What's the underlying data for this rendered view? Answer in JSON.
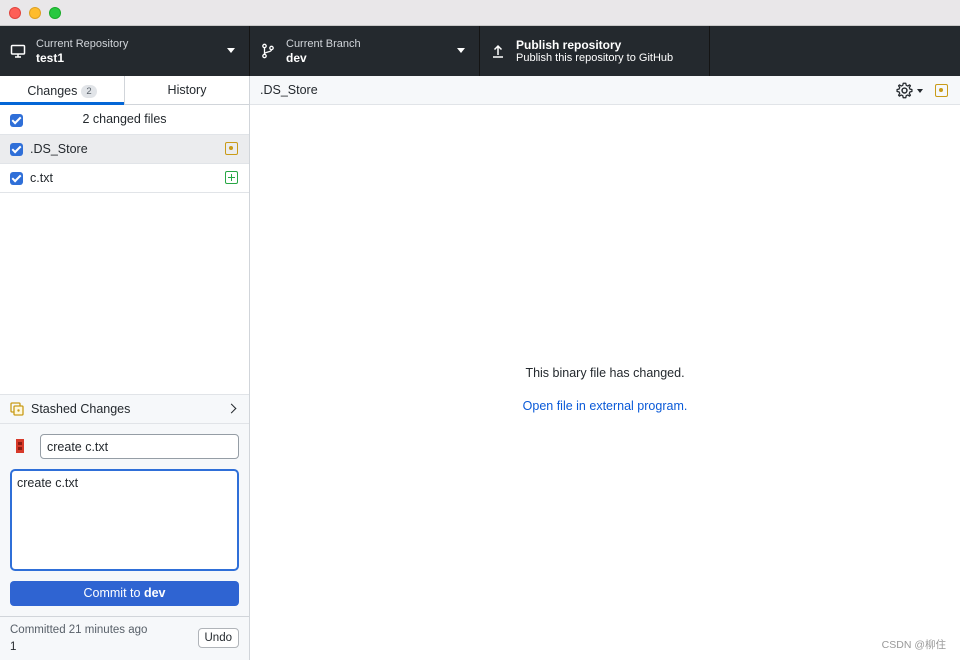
{
  "toolbar": {
    "repo": {
      "label": "Current Repository",
      "value": "test1"
    },
    "branch": {
      "label": "Current Branch",
      "value": "dev"
    },
    "publish": {
      "title": "Publish repository",
      "subtitle": "Publish this repository to GitHub"
    }
  },
  "sidebar": {
    "tabs": [
      {
        "label": "Changes",
        "badge": "2",
        "active": true
      },
      {
        "label": "History",
        "active": false
      }
    ],
    "files_header": "2 changed files",
    "files": [
      {
        "name": ".DS_Store",
        "status": "modified",
        "status_icon": "file-modified-icon",
        "checked": true,
        "selected": true
      },
      {
        "name": "c.txt",
        "status": "added",
        "status_icon": "file-added-icon",
        "checked": true,
        "selected": false
      }
    ],
    "stash_label": "Stashed Changes",
    "commit": {
      "summary": "create c.txt",
      "description": "create c.txt",
      "button_prefix": "Commit to",
      "button_branch": "dev"
    },
    "last_commit": {
      "text": "Committed 21 minutes ago",
      "summary": "1",
      "undo_label": "Undo"
    }
  },
  "main": {
    "path": ".DS_Store",
    "message": "This binary file has changed.",
    "link": "Open file in external program."
  },
  "watermark": "CSDN @柳住",
  "colors": {
    "accent": "#2f64d2",
    "toolbar_bg": "#24292e",
    "modified": "#c99b18",
    "added": "#28a745",
    "link": "#0a5ad8"
  }
}
